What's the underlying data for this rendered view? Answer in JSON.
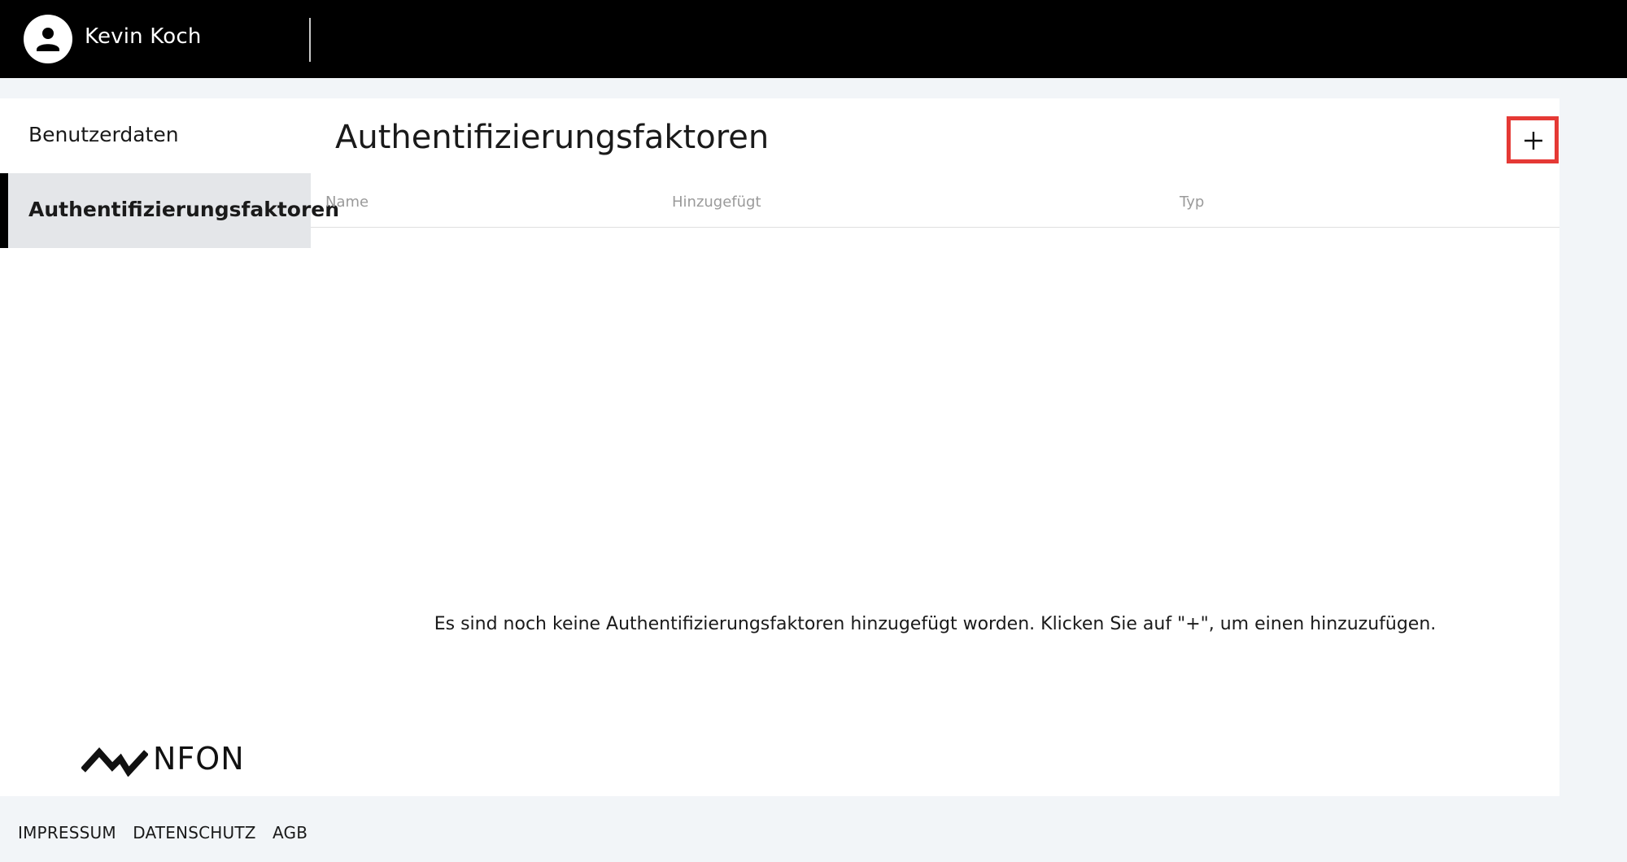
{
  "header": {
    "user_name": "Kevin Koch",
    "avatar_icon": "user-icon"
  },
  "sidebar": {
    "items": [
      {
        "label": "Benutzerdaten",
        "active": false
      },
      {
        "label": "Authentifizierungsfaktoren",
        "active": true
      }
    ]
  },
  "main": {
    "title": "Authentifizierungsfaktoren",
    "add_button_icon": "plus-icon",
    "table": {
      "columns": [
        "Name",
        "Hinzugefügt",
        "Typ"
      ],
      "rows": []
    },
    "empty_message": "Es sind noch keine Authentifizierungsfaktoren hinzugefügt worden. Klicken Sie auf \"+\", um einen hinzuzufügen."
  },
  "logo": {
    "text": "NFON",
    "icon": "nfon-logo-icon"
  },
  "footer": {
    "links": [
      "IMPRESSUM",
      "DATENSCHUTZ",
      "AGB"
    ]
  },
  "colors": {
    "topbar": "#000000",
    "highlight": "#e53935",
    "active_item_bg": "#e4e6e9"
  }
}
